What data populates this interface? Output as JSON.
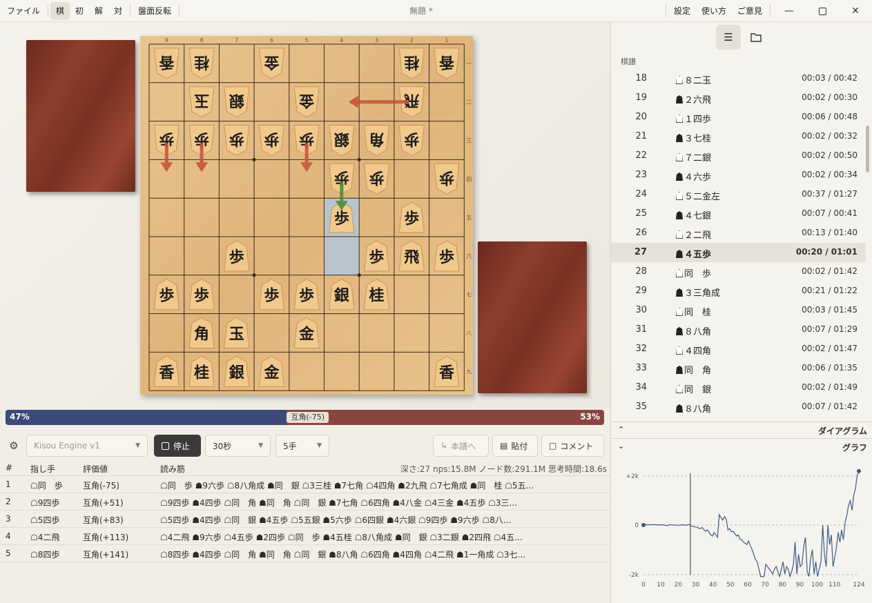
{
  "menu": {
    "file": "ファイル",
    "modes": [
      "棋",
      "初",
      "解",
      "対"
    ],
    "flip": "盤面反転",
    "title": "無題 *",
    "settings": "設定",
    "usage": "使い方",
    "feedback": "ご意見"
  },
  "board": {
    "files": [
      "9",
      "8",
      "7",
      "6",
      "5",
      "4",
      "3",
      "2",
      "1"
    ],
    "ranks": [
      "一",
      "二",
      "三",
      "四",
      "五",
      "六",
      "七",
      "八",
      "九"
    ],
    "pieces": [
      {
        "f": 9,
        "r": 1,
        "k": "香",
        "o": "w"
      },
      {
        "f": 8,
        "r": 1,
        "k": "桂",
        "o": "w"
      },
      {
        "f": 6,
        "r": 1,
        "k": "金",
        "o": "w"
      },
      {
        "f": 2,
        "r": 1,
        "k": "桂",
        "o": "w"
      },
      {
        "f": 1,
        "r": 1,
        "k": "香",
        "o": "w"
      },
      {
        "f": 8,
        "r": 2,
        "k": "玉",
        "o": "w"
      },
      {
        "f": 7,
        "r": 2,
        "k": "銀",
        "o": "w"
      },
      {
        "f": 5,
        "r": 2,
        "k": "金",
        "o": "w"
      },
      {
        "f": 2,
        "r": 2,
        "k": "飛",
        "o": "w"
      },
      {
        "f": 9,
        "r": 3,
        "k": "歩",
        "o": "w"
      },
      {
        "f": 8,
        "r": 3,
        "k": "歩",
        "o": "w"
      },
      {
        "f": 7,
        "r": 3,
        "k": "歩",
        "o": "w"
      },
      {
        "f": 6,
        "r": 3,
        "k": "歩",
        "o": "w"
      },
      {
        "f": 5,
        "r": 3,
        "k": "歩",
        "o": "w"
      },
      {
        "f": 4,
        "r": 3,
        "k": "銀",
        "o": "w"
      },
      {
        "f": 3,
        "r": 3,
        "k": "角",
        "o": "w"
      },
      {
        "f": 2,
        "r": 3,
        "k": "歩",
        "o": "w"
      },
      {
        "f": 4,
        "r": 4,
        "k": "歩",
        "o": "w"
      },
      {
        "f": 3,
        "r": 4,
        "k": "歩",
        "o": "w"
      },
      {
        "f": 1,
        "r": 4,
        "k": "歩",
        "o": "w"
      },
      {
        "f": 4,
        "r": 5,
        "k": "歩",
        "o": "b"
      },
      {
        "f": 2,
        "r": 5,
        "k": "歩",
        "o": "b"
      },
      {
        "f": 7,
        "r": 6,
        "k": "歩",
        "o": "b"
      },
      {
        "f": 3,
        "r": 6,
        "k": "歩",
        "o": "b"
      },
      {
        "f": 2,
        "r": 6,
        "k": "飛",
        "o": "b"
      },
      {
        "f": 1,
        "r": 6,
        "k": "歩",
        "o": "b"
      },
      {
        "f": 9,
        "r": 7,
        "k": "歩",
        "o": "b"
      },
      {
        "f": 8,
        "r": 7,
        "k": "歩",
        "o": "b"
      },
      {
        "f": 6,
        "r": 7,
        "k": "歩",
        "o": "b"
      },
      {
        "f": 5,
        "r": 7,
        "k": "歩",
        "o": "b"
      },
      {
        "f": 4,
        "r": 7,
        "k": "銀",
        "o": "b"
      },
      {
        "f": 3,
        "r": 7,
        "k": "桂",
        "o": "b"
      },
      {
        "f": 8,
        "r": 8,
        "k": "角",
        "o": "b"
      },
      {
        "f": 7,
        "r": 8,
        "k": "玉",
        "o": "b"
      },
      {
        "f": 5,
        "r": 8,
        "k": "金",
        "o": "b"
      },
      {
        "f": 9,
        "r": 9,
        "k": "香",
        "o": "b"
      },
      {
        "f": 8,
        "r": 9,
        "k": "桂",
        "o": "b"
      },
      {
        "f": 7,
        "r": 9,
        "k": "銀",
        "o": "b"
      },
      {
        "f": 6,
        "r": 9,
        "k": "金",
        "o": "b"
      },
      {
        "f": 1,
        "r": 9,
        "k": "香",
        "o": "b"
      }
    ],
    "highlights": [
      {
        "f": 4,
        "r": 5
      },
      {
        "f": 4,
        "r": 6
      }
    ],
    "arrows": [
      {
        "from": {
          "f": 2,
          "r": 2
        },
        "to": {
          "f": 4,
          "r": 2
        },
        "color": "#c8553d"
      },
      {
        "from": {
          "f": 9,
          "r": 3
        },
        "to": {
          "f": 9,
          "r": 4
        },
        "color": "#c8553d"
      },
      {
        "from": {
          "f": 8,
          "r": 3
        },
        "to": {
          "f": 8,
          "r": 4
        },
        "color": "#c8553d"
      },
      {
        "from": {
          "f": 5,
          "r": 3
        },
        "to": {
          "f": 5,
          "r": 4
        },
        "color": "#c8553d"
      },
      {
        "from": {
          "f": 4,
          "r": 4
        },
        "to": {
          "f": 4,
          "r": 5
        },
        "color": "#4e8a3a"
      }
    ],
    "colors": {
      "piece": "#f2c98c",
      "pieceEdge": "#c9955a",
      "ink": "#1c1c1c",
      "grid": "#3b2a18",
      "highlight": "#b8c4cc"
    }
  },
  "eval": {
    "left_pct": 47,
    "left_label": "47%",
    "right_label": "53%",
    "mid_label": "互角(-75)",
    "colors": {
      "left": "#3c4a7a",
      "right": "#8b4540"
    }
  },
  "controls": {
    "engine": "Kisou Engine v1",
    "stop": "停止",
    "time": "30秒",
    "depth": "5手",
    "to_kifu": "本譜へ",
    "paste": "貼付",
    "comment": "コメント"
  },
  "pv": {
    "headers": {
      "no": "#",
      "move": "指し手",
      "eval": "評価値",
      "line": "読み筋"
    },
    "stats": "深さ:27 nps:15.8M ノード数:291.1M 思考時間:18.6s",
    "rows": [
      {
        "no": "1",
        "move": "☖同　歩",
        "eval": "互角(-75)",
        "line": "☖同　歩 ☗9六歩 ☖8八角成 ☗同　銀 ☖3三桂 ☗7七角 ☖4四角 ☗2九飛 ☖7七角成 ☗同　桂 ☖5五..."
      },
      {
        "no": "2",
        "move": "☖9四歩",
        "eval": "互角(+51)",
        "line": "☖9四歩 ☗4四歩 ☖同　角 ☗同　角 ☖同　銀 ☗7七角 ☖6四角 ☗4八金 ☖4三金 ☗4五歩 ☖3三..."
      },
      {
        "no": "3",
        "move": "☖5四歩",
        "eval": "互角(+83)",
        "line": "☖5四歩 ☗4四歩 ☖同　銀 ☗4五歩 ☖5五銀 ☗5六歩 ☖6四銀 ☗4六銀 ☖9四歩 ☗9六歩 ☖8八..."
      },
      {
        "no": "4",
        "move": "☖4二飛",
        "eval": "互角(+113)",
        "line": "☖4二飛 ☗9六歩 ☖4五歩 ☗2四歩 ☖同　歩 ☗4五桂 ☖8八角成 ☗同　銀 ☖3二銀 ☗2四飛 ☖4五..."
      },
      {
        "no": "5",
        "move": "☖8四歩",
        "eval": "互角(+141)",
        "line": "☖8四歩 ☗4四歩 ☖同　角 ☗同　角 ☖同　銀 ☗8八角 ☖6四角 ☗4四角 ☖4二飛 ☗1一角成 ☖3七..."
      }
    ]
  },
  "kifu": {
    "label": "棋譜",
    "moves": [
      {
        "n": "18",
        "s": "w",
        "m": "８二玉",
        "t": "00:03 / 00:42"
      },
      {
        "n": "19",
        "s": "b",
        "m": "２六飛",
        "t": "00:02 / 00:30"
      },
      {
        "n": "20",
        "s": "w",
        "m": "１四歩",
        "t": "00:06 / 00:48"
      },
      {
        "n": "21",
        "s": "b",
        "m": "３七桂",
        "t": "00:02 / 00:32"
      },
      {
        "n": "22",
        "s": "w",
        "m": "７二銀",
        "t": "00:02 / 00:50"
      },
      {
        "n": "23",
        "s": "b",
        "m": "４六歩",
        "t": "00:02 / 00:34"
      },
      {
        "n": "24",
        "s": "w",
        "m": "５二金左",
        "t": "00:37 / 01:27"
      },
      {
        "n": "25",
        "s": "b",
        "m": "４七銀",
        "t": "00:07 / 00:41"
      },
      {
        "n": "26",
        "s": "w",
        "m": "２二飛",
        "t": "00:13 / 01:40"
      },
      {
        "n": "27",
        "s": "b",
        "m": "４五歩",
        "t": "00:20 / 01:01"
      },
      {
        "n": "28",
        "s": "w",
        "m": "同　歩",
        "t": "00:02 / 01:42"
      },
      {
        "n": "29",
        "s": "b",
        "m": "３三角成",
        "t": "00:21 / 01:22"
      },
      {
        "n": "30",
        "s": "w",
        "m": "同　桂",
        "t": "00:03 / 01:45"
      },
      {
        "n": "31",
        "s": "b",
        "m": "８八角",
        "t": "00:07 / 01:29"
      },
      {
        "n": "32",
        "s": "w",
        "m": "４四角",
        "t": "00:02 / 01:47"
      },
      {
        "n": "33",
        "s": "b",
        "m": "同　角",
        "t": "00:06 / 01:35"
      },
      {
        "n": "34",
        "s": "w",
        "m": "同　銀",
        "t": "00:02 / 01:49"
      },
      {
        "n": "35",
        "s": "b",
        "m": "８八角",
        "t": "00:07 / 01:42"
      }
    ],
    "selected": "27"
  },
  "sections": {
    "diagram": "ダイアグラム",
    "graph": "グラフ"
  },
  "graph": {
    "y_ticks": [
      "+2k",
      "0",
      "-2k"
    ],
    "x_ticks": [
      "0",
      "10",
      "20",
      "30",
      "40",
      "50",
      "60",
      "70",
      "80",
      "90",
      "100",
      "110",
      "124"
    ],
    "x_tick_vals": [
      0,
      10,
      20,
      30,
      40,
      50,
      60,
      70,
      80,
      90,
      100,
      110,
      124
    ],
    "x_max": 124,
    "cursor": 27,
    "line_color": "#3d5a80",
    "values": [
      0,
      10,
      15,
      5,
      20,
      10,
      15,
      20,
      10,
      0,
      10,
      15,
      0,
      -10,
      -20,
      10,
      5,
      0,
      10,
      -5,
      -10,
      -5,
      5,
      10,
      0,
      -10,
      20,
      10,
      -40,
      -60,
      -80,
      -90,
      -120,
      -150,
      -100,
      -180,
      -250,
      -200,
      -280,
      -400,
      -450,
      -300,
      -400,
      -500,
      420,
      300,
      200,
      350,
      250,
      -200,
      -150,
      -280,
      -250,
      -350,
      -450,
      -400,
      -580,
      -600,
      -700,
      -750,
      -800,
      -650,
      -850,
      -1000,
      -1200,
      -1400,
      -1500,
      -1800,
      -2100,
      -2100,
      -2100,
      -1600,
      -1700,
      -1800,
      -1900,
      -2000,
      -1800,
      -1700,
      -1900,
      -2100,
      -1800,
      -1500,
      -2000,
      -1700,
      -1800,
      -2100,
      -1900,
      -1600,
      -700,
      -2000,
      -1200,
      -1700,
      -1600,
      -900,
      -500,
      -1900,
      -2100,
      -1400,
      -1000,
      -2000,
      -1500,
      -2100,
      -1800,
      -1500,
      0,
      -1200,
      -1700,
      0,
      -800,
      -400,
      -1700,
      -1300,
      -900,
      -300,
      -700,
      -200,
      -600,
      100,
      400,
      800,
      1000,
      600,
      1200,
      1500,
      2000,
      2200
    ]
  }
}
